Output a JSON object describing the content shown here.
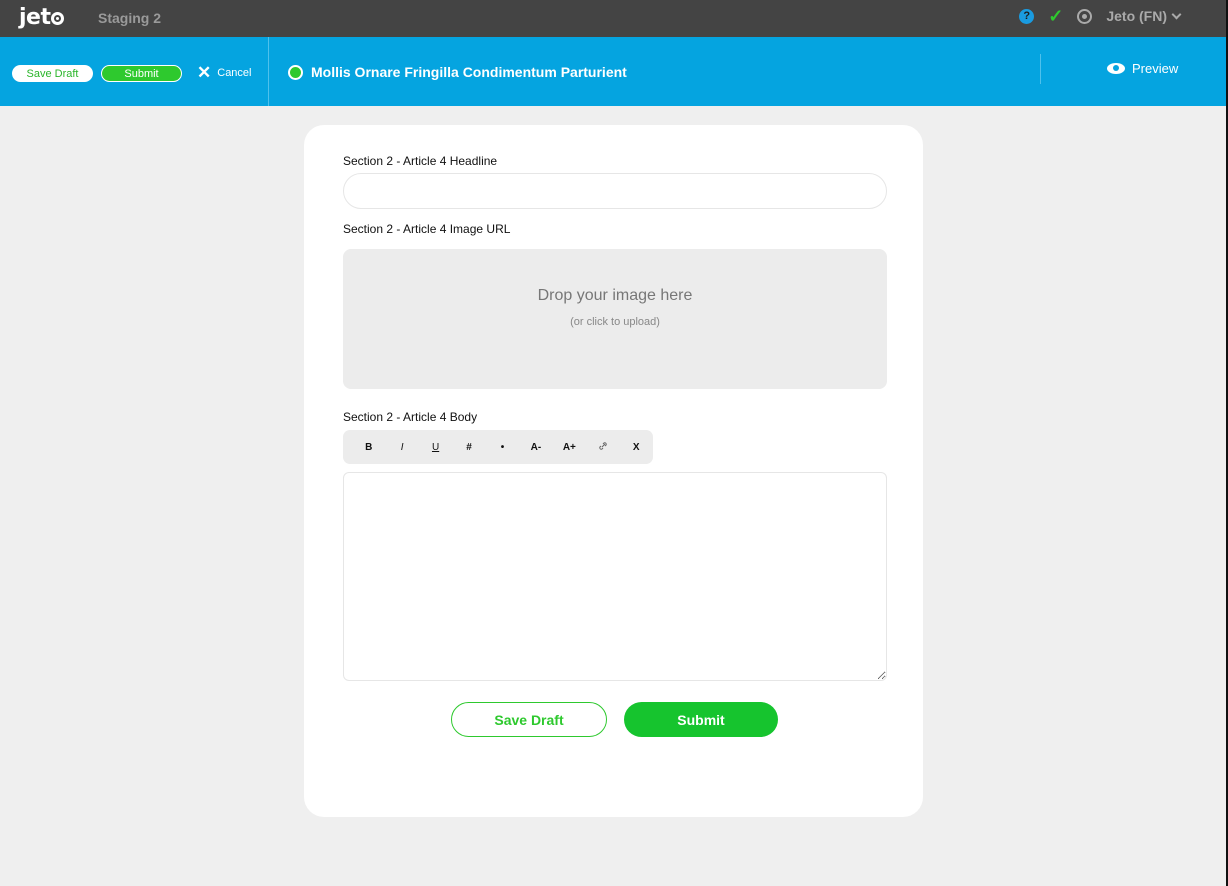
{
  "topbar": {
    "logo_text": "jet",
    "environment": "Staging 2",
    "help_icon": "?",
    "status_icon": "check-icon",
    "settings_icon": "gear-icon",
    "user_label": "Jeto (FN)"
  },
  "actionbar": {
    "save_draft_label": "Save Draft",
    "submit_label": "Submit",
    "cancel_label": "Cancel",
    "document_title": "Mollis Ornare Fringilla Condimentum Parturient",
    "preview_label": "Preview"
  },
  "form": {
    "headline_label": "Section 2 - Article 4 Headline",
    "headline_value": "",
    "image_label": "Section 2 - Article 4 Image URL",
    "dropzone_text": "Drop your image here",
    "dropzone_subtext": "(or click to upload)",
    "body_label": "Section 2 - Article 4 Body",
    "toolbar": [
      "B",
      "I",
      "U",
      "#",
      "•",
      "A-",
      "A+",
      "🔗",
      "X"
    ],
    "body_value": "",
    "save_draft_label": "Save Draft",
    "submit_label": "Submit"
  },
  "colors": {
    "topbar": "#444444",
    "actionbar": "#05a4e0",
    "accent_green": "#2ec92e"
  }
}
